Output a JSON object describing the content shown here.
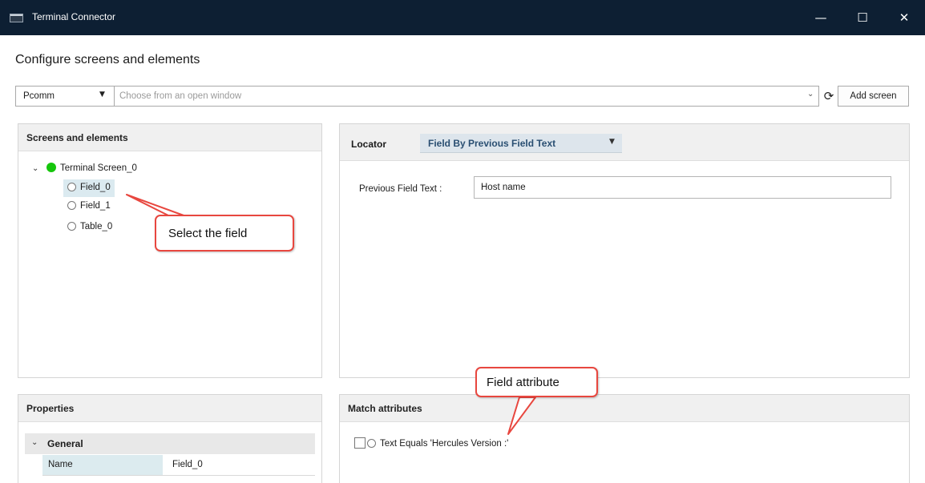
{
  "window": {
    "title": "Terminal Connector",
    "controls": {
      "minimize": "—",
      "maximize": "☐",
      "close": "✕"
    }
  },
  "page_title": "Configure screens and elements",
  "toolbar": {
    "app_type_value": "Pcomm",
    "window_placeholder": "Choose from an open window",
    "add_screen_label": "Add screen"
  },
  "screens_panel": {
    "header": "Screens and elements",
    "tree": {
      "root_label": "Terminal Screen_0",
      "root_status_color": "#16c60c",
      "children": [
        {
          "label": "Field_0",
          "selected": true
        },
        {
          "label": "Field_1",
          "selected": false
        },
        {
          "label": "Table_0",
          "selected": false
        }
      ]
    }
  },
  "locator_panel": {
    "header": "Locator",
    "locator_type": "Field By Previous Field Text",
    "previous_field_text_label": "Previous Field Text :",
    "previous_field_text_value": "Host name"
  },
  "properties_panel": {
    "header": "Properties",
    "section": "General",
    "rows": [
      {
        "key": "Name",
        "value": "Field_0"
      }
    ]
  },
  "match_panel": {
    "header": "Match attributes",
    "attributes": [
      {
        "label": "Text Equals 'Hercules Version  :'",
        "checked": false
      }
    ]
  },
  "annotations": {
    "select_field": "Select the field",
    "field_attribute": "Field attribute",
    "accent_color": "#e8473f"
  },
  "colors": {
    "titlebar": "#0d1f33",
    "selection": "#dbeaf0",
    "locator_text": "#2a4f72"
  }
}
